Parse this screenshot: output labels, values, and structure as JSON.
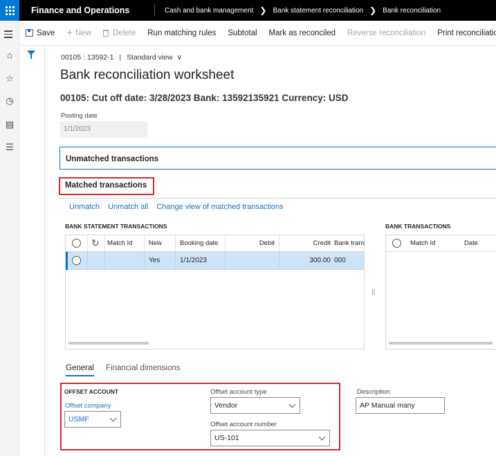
{
  "app": {
    "title": "Finance and Operations",
    "breadcrumb": [
      "Cash and bank management",
      "Bank statement reconciliation",
      "Bank reconciliation"
    ]
  },
  "actions": {
    "save": "Save",
    "new": "New",
    "delete": "Delete",
    "run_matching_rules": "Run matching rules",
    "subtotal": "Subtotal",
    "mark_as_reconciled": "Mark as reconciled",
    "reverse_reconciliation": "Reverse reconciliation",
    "print_reconciliation": "Print reconciliation sta"
  },
  "header": {
    "record": "00105 : 13592-1",
    "separator": "|",
    "view": "Standard view",
    "title": "Bank reconciliation worksheet",
    "subtitle": "00105: Cut off date: 3/28/2023 Bank: 13592135921 Currency: USD",
    "posting_date_label": "Posting date",
    "posting_date_value": "1/1/2023"
  },
  "fasttabs": {
    "unmatched": "Unmatched transactions",
    "matched": "Matched transactions"
  },
  "matched_links": {
    "unmatch": "Unmatch",
    "unmatch_all": "Unmatch all",
    "change_view": "Change view of matched transactions"
  },
  "bank_statement_grid": {
    "title": "BANK STATEMENT TRANSACTIONS",
    "columns": {
      "match_id": "Match Id",
      "new": "New",
      "booking_date": "Booking date",
      "debit": "Debit",
      "credit": "Credit",
      "bank_trans": "Bank trans"
    },
    "rows": [
      {
        "match_id": "",
        "new": "Yes",
        "booking_date": "1/1/2023",
        "debit": "",
        "credit": "300.00",
        "bank_trans": "000"
      }
    ]
  },
  "bank_grid": {
    "title": "BANK TRANSACTIONS",
    "columns": {
      "match_id": "Match Id",
      "date": "Date"
    }
  },
  "splitter": "||",
  "detail_tabs": {
    "general": "General",
    "financial_dimensions": "Financial dimensions"
  },
  "offset": {
    "title": "OFFSET ACCOUNT",
    "company_label": "Offset company",
    "company_value": "USMF",
    "type_label": "Offset account type",
    "type_value": "Vendor",
    "number_label": "Offset account number",
    "number_value": "US-101",
    "description_label": "Description",
    "description_value": "AP Manual many"
  },
  "colors": {
    "topbar": "#000000",
    "accent": "#0078d4",
    "highlight_box": "#d02b2b",
    "selected_row": "#cfe3f8",
    "link": "#1a6fc2"
  }
}
